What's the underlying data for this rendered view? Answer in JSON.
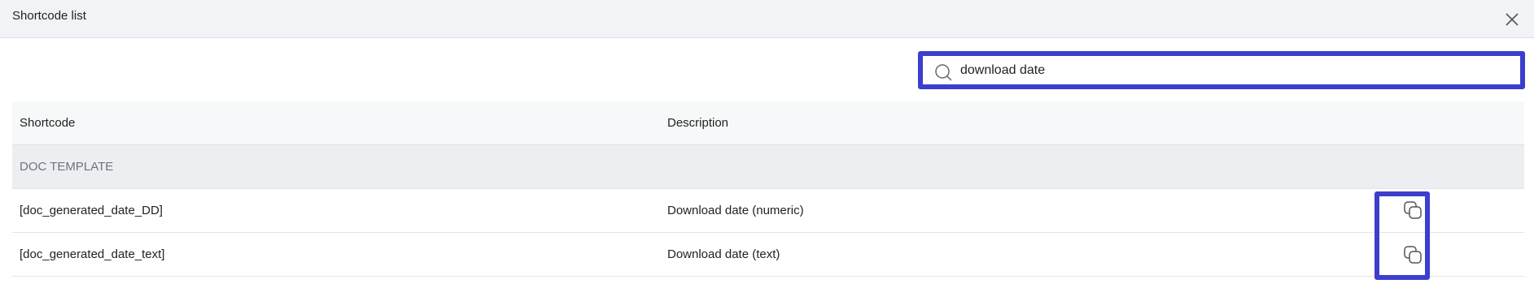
{
  "header": {
    "title": "Shortcode list"
  },
  "search": {
    "value": "download date"
  },
  "table": {
    "columns": [
      "Shortcode",
      "Description"
    ],
    "group": "DOC TEMPLATE",
    "rows": [
      {
        "shortcode": "[doc_generated_date_DD]",
        "description": "Download date (numeric)"
      },
      {
        "shortcode": "[doc_generated_date_text]",
        "description": "Download date (text)"
      }
    ]
  },
  "colors": {
    "highlight": "#3b3fcc",
    "header_bg": "#f1f3f6"
  },
  "icons": {
    "close": "close-icon",
    "search": "search-icon",
    "copy": "copy-icon"
  }
}
